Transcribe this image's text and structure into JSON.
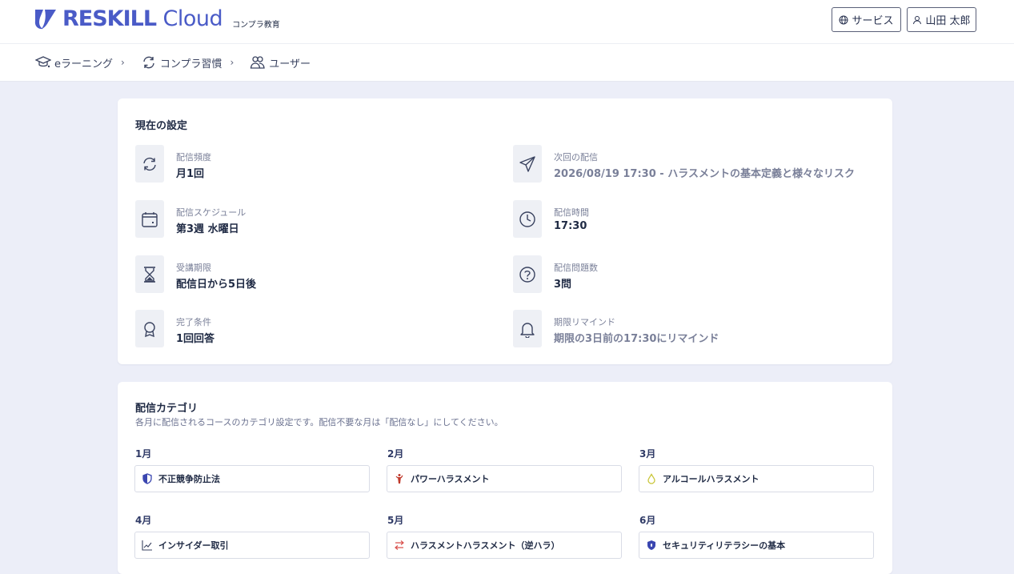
{
  "header": {
    "brand": "RESKILL",
    "brand_cloud": "Cloud",
    "subtitle": "コンプラ教育",
    "service_button": "サービス",
    "user_button": "山田 太郎"
  },
  "nav": {
    "items": [
      {
        "label": "eラーニング",
        "icon": "graduation-cap-icon"
      },
      {
        "label": "コンプラ習慣",
        "icon": "refresh-icon"
      },
      {
        "label": "ユーザー",
        "icon": "users-icon"
      }
    ],
    "chevron": "›"
  },
  "settings": {
    "title": "現在の設定",
    "items": [
      {
        "label": "配信頻度",
        "value": "月1回",
        "icon": "refresh-icon"
      },
      {
        "label": "次回の配信",
        "value": "2026/08/19 17:30 - ハラスメントの基本定義と様々なリスク",
        "icon": "send-icon"
      },
      {
        "label": "配信スケジュール",
        "value": "第3週 水曜日",
        "icon": "calendar-icon"
      },
      {
        "label": "配信時間",
        "value": "17:30",
        "icon": "clock-icon"
      },
      {
        "label": "受講期限",
        "value": "配信日から5日後",
        "icon": "hourglass-icon"
      },
      {
        "label": "配信問題数",
        "value": "3問",
        "icon": "question-icon"
      },
      {
        "label": "完了条件",
        "value": "1回回答",
        "icon": "award-icon"
      },
      {
        "label": "期限リマインド",
        "value": "期限の3日前の17:30にリマインド",
        "icon": "bell-icon"
      }
    ]
  },
  "categories": {
    "title": "配信カテゴリ",
    "description": "各月に配信されるコースのカテゴリ設定です。配信不要な月は「配信なし」にしてください。",
    "months": [
      {
        "month": "1月",
        "category": "不正競争防止法",
        "icon": "shield-icon",
        "color": "#3a46b0"
      },
      {
        "month": "2月",
        "category": "パワーハラスメント",
        "icon": "person-alert-icon",
        "color": "#c0392b"
      },
      {
        "month": "3月",
        "category": "アルコールハラスメント",
        "icon": "drop-icon",
        "color": "#c9c63a"
      },
      {
        "month": "4月",
        "category": "インサイダー取引",
        "icon": "trend-chart-icon",
        "color": "#3a4360"
      },
      {
        "month": "5月",
        "category": "ハラスメントハラスメント（逆ハラ）",
        "icon": "swap-arrows-icon",
        "color": "#d9534f"
      },
      {
        "month": "6月",
        "category": "セキュリティリテラシーの基本",
        "icon": "shield-check-icon",
        "color": "#3a46b0"
      }
    ]
  }
}
